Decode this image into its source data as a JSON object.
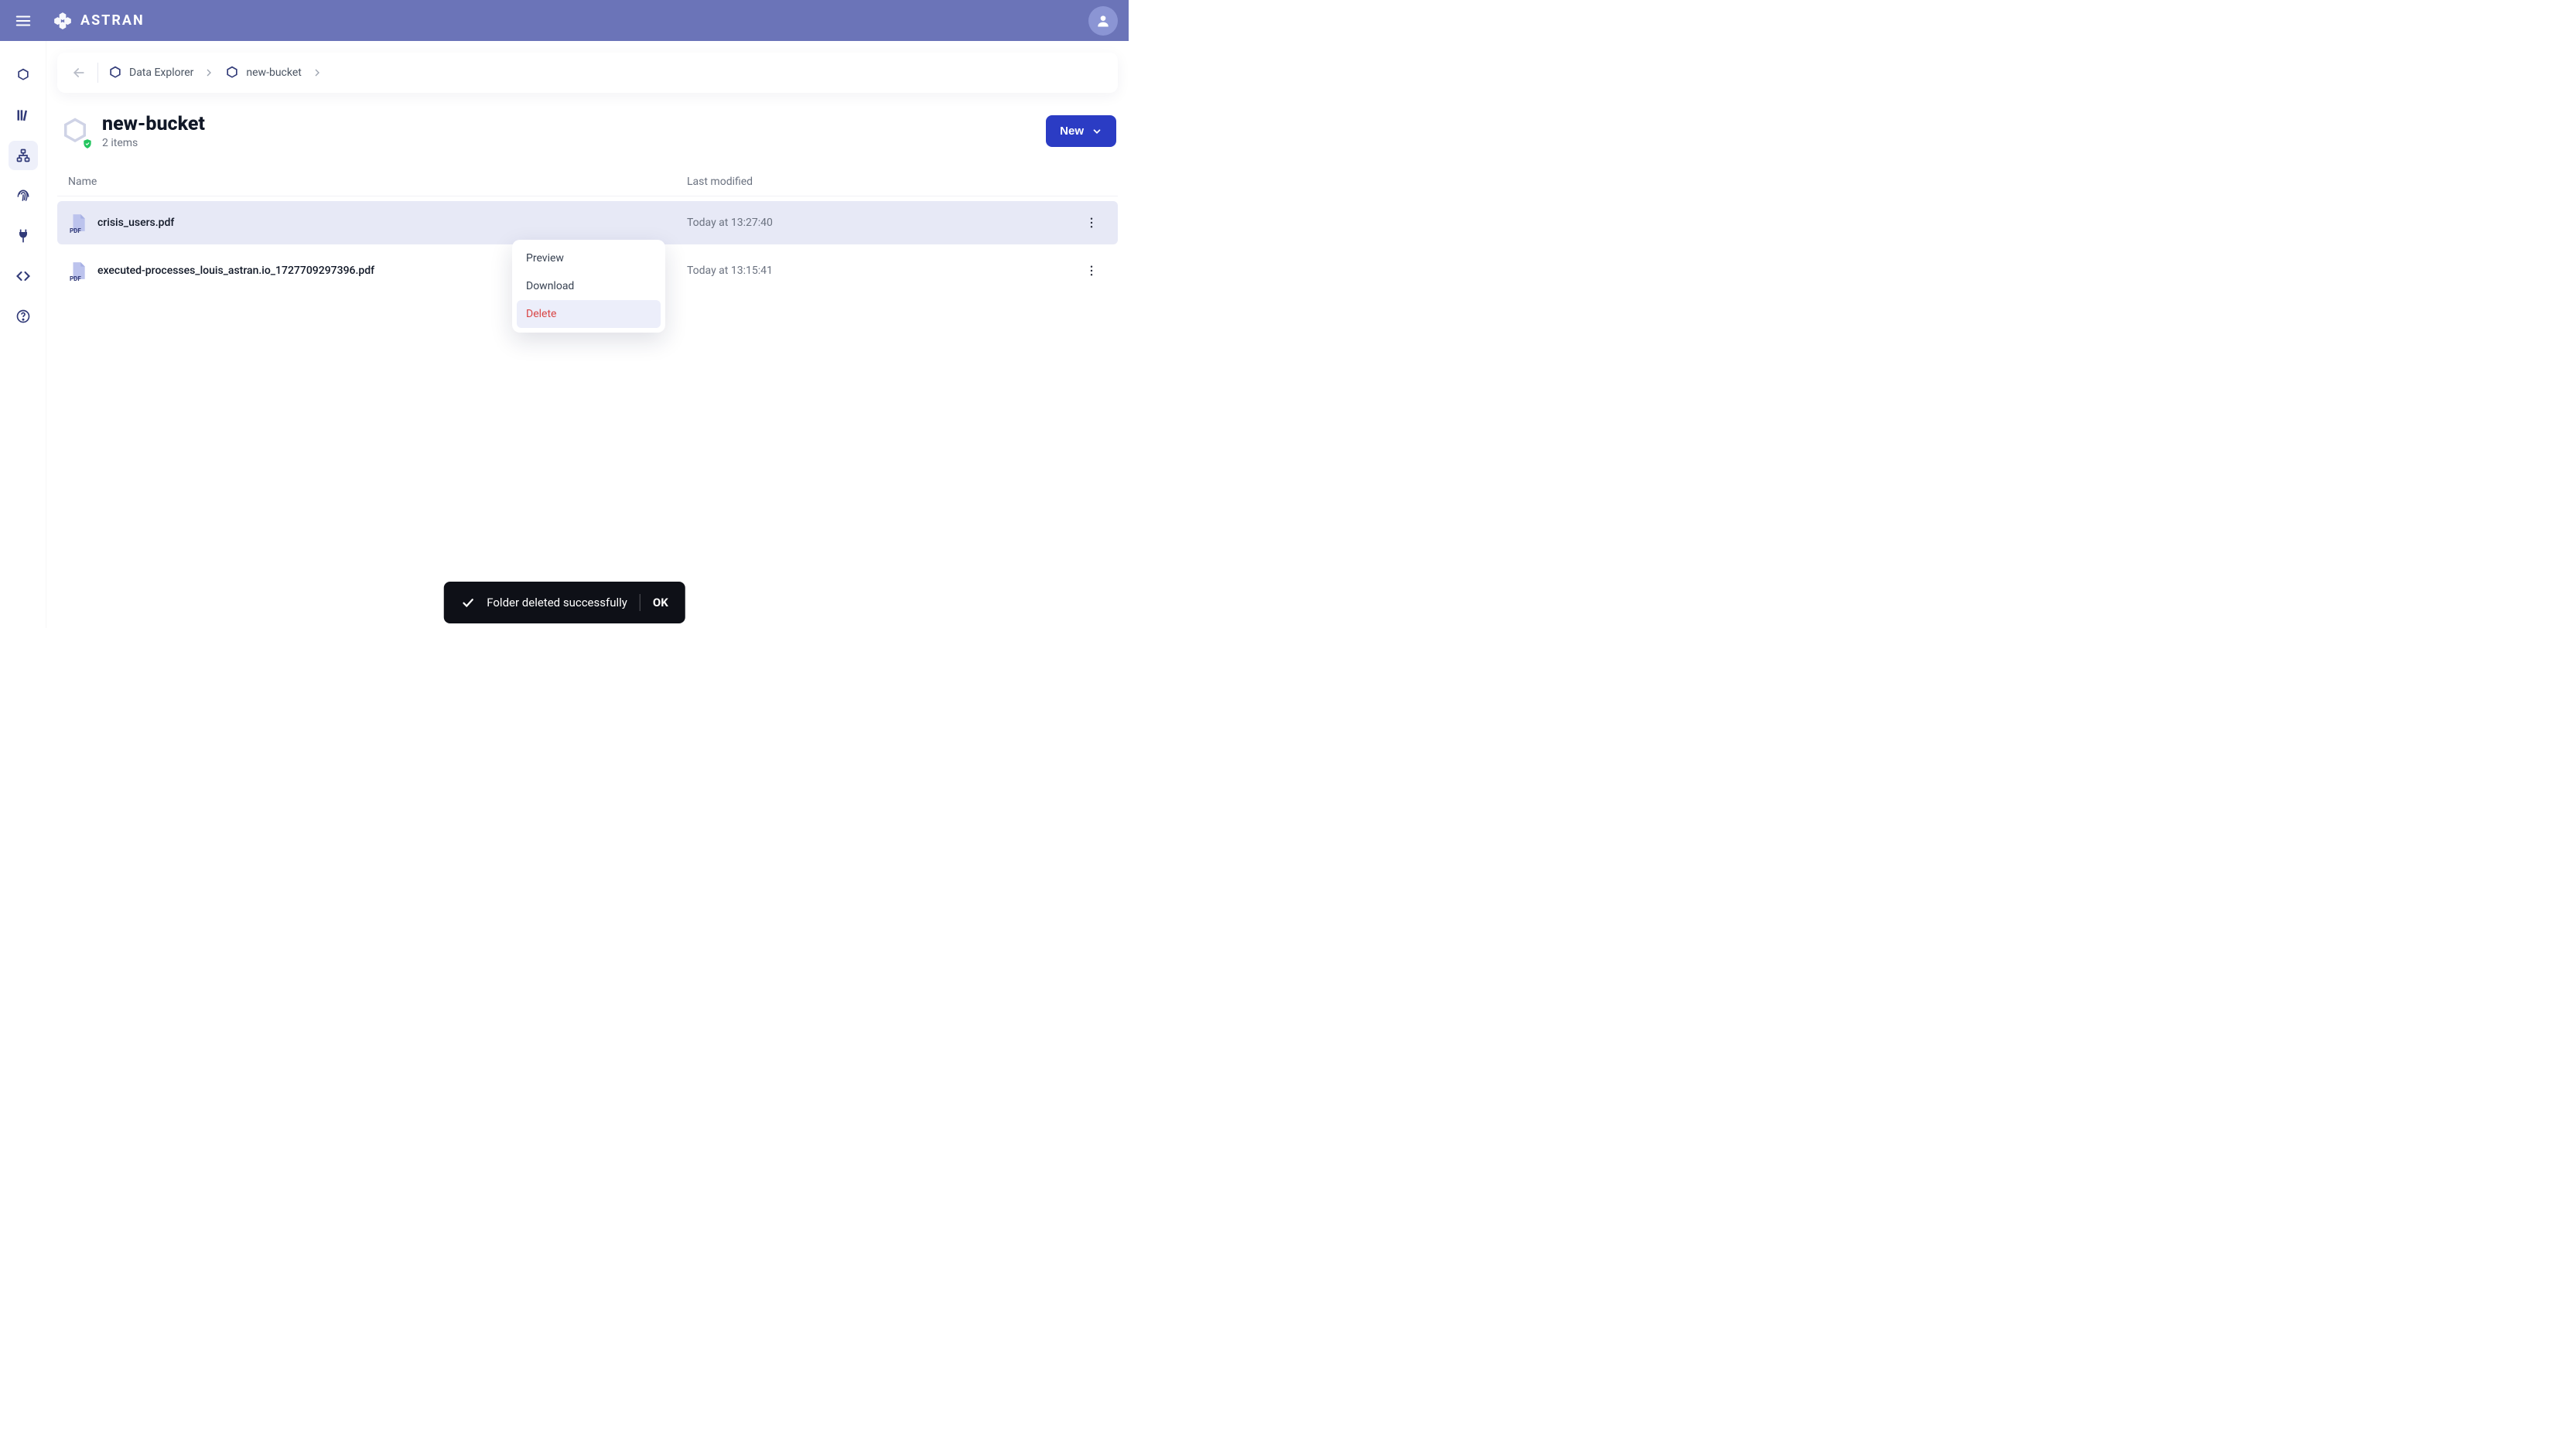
{
  "brand": {
    "name": "ASTRAN"
  },
  "sidebar": {
    "items": [
      {
        "name": "nav-home",
        "active": false
      },
      {
        "name": "nav-library",
        "active": false
      },
      {
        "name": "nav-data-explorer",
        "active": true
      },
      {
        "name": "nav-fingerprint",
        "active": false
      },
      {
        "name": "nav-integrations",
        "active": false
      },
      {
        "name": "nav-developers",
        "active": false
      },
      {
        "name": "nav-help",
        "active": false
      }
    ]
  },
  "breadcrumb": {
    "items": [
      {
        "label": "Data Explorer"
      },
      {
        "label": "new-bucket"
      }
    ]
  },
  "page": {
    "title": "new-bucket",
    "subtitle": "2 items",
    "new_button": "New"
  },
  "table": {
    "columns": {
      "name": "Name",
      "modified": "Last modified"
    },
    "rows": [
      {
        "name": "crisis_users.pdf",
        "modified": "Today at 13:27:40",
        "selected": true
      },
      {
        "name": "executed-processes_louis_astran.io_1727709297396.pdf",
        "modified": "Today at 13:15:41",
        "selected": false
      }
    ]
  },
  "context_menu": {
    "items": [
      {
        "label": "Preview",
        "danger": false,
        "hovered": false
      },
      {
        "label": "Download",
        "danger": false,
        "hovered": false
      },
      {
        "label": "Delete",
        "danger": true,
        "hovered": true
      }
    ]
  },
  "toast": {
    "message": "Folder deleted successfully",
    "ok": "OK"
  }
}
